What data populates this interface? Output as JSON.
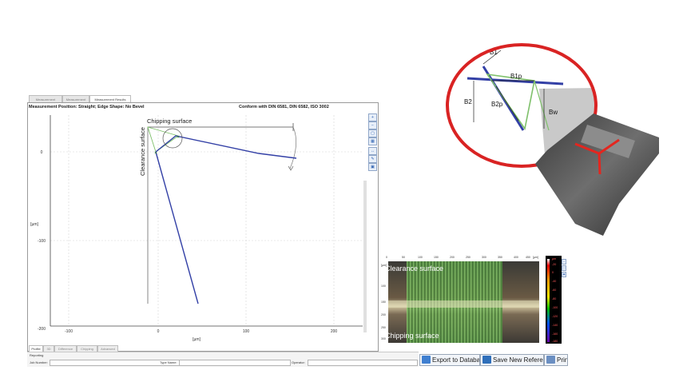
{
  "window_tabs": [
    "Measurement Settings",
    "Measurement",
    "Measurement Results"
  ],
  "info": {
    "position_label": "Measurement Position: Straight; Edge Shape: No Bevel",
    "conform_label": "Conform with DIN 6581, DIN 6582, ISO 3002"
  },
  "plot": {
    "y_ticks": [
      "0",
      "-100",
      "-200"
    ],
    "x_ticks": [
      "-100",
      "0",
      "100",
      "200"
    ],
    "y_unit": "[µm]",
    "x_unit": "[µm]",
    "chipping_label": "Chipping surface",
    "clearance_label": "Clearance surface"
  },
  "bottom_tabs": [
    "Profile",
    "3D",
    "Difference",
    "Chipping",
    "Advanced"
  ],
  "reporting": {
    "title": "Reporting",
    "job_label": "Job Number:",
    "type_label": "Type Name:",
    "operator_label": "Operator:"
  },
  "actions": {
    "export": "Export to Database",
    "save_ref": "Save New Reference",
    "print": "Print"
  },
  "thumb": {
    "clearance": "Clearance surface",
    "chipping": "Chipping surface",
    "top_ticks": [
      "0",
      "50",
      "100",
      "150",
      "200",
      "250",
      "300",
      "350",
      "400",
      "450"
    ],
    "top_unit": "[µm]",
    "left_ticks": [
      "100",
      "150",
      "200",
      "250",
      "300"
    ],
    "left_unit": "[µm]"
  },
  "colorbar": {
    "unit": "µm",
    "ticks": [
      "-20",
      "0",
      "-40",
      "-60",
      "-80",
      "-100",
      "-120",
      "-140",
      "-160",
      "-180"
    ]
  },
  "zoom": {
    "labels": [
      "B1",
      "B1p",
      "B2",
      "B2p",
      "Bw"
    ]
  },
  "colors": {
    "profile": "#3340a6",
    "chamfer": "#7ec06a",
    "zoom_ring": "#d92323",
    "accent_red": "#e3261f"
  }
}
